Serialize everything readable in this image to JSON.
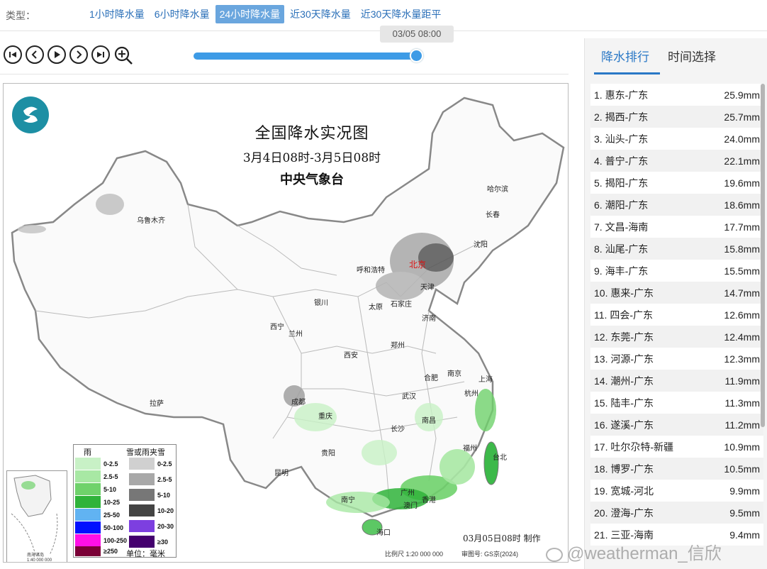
{
  "type_bar": {
    "label": "类型：",
    "tabs": [
      {
        "label": "1小时降水量"
      },
      {
        "label": "6小时降水量"
      },
      {
        "label": "24小时降水量",
        "active": true
      },
      {
        "label": "近30天降水量"
      },
      {
        "label": "近30天降水量距平"
      }
    ]
  },
  "timeline": {
    "current_time": "03/05 08:00",
    "progress": 1.0,
    "controls": [
      "first-icon",
      "prev-icon",
      "play-icon",
      "next-icon",
      "last-icon",
      "zoom-in-icon"
    ]
  },
  "map": {
    "title": "全国降水实况图",
    "period": "3月4日08时-3月5日08时",
    "agency": "中央气象台",
    "made_time": "03月05日08时 制作",
    "scale": "比例尺 1:20 000 000",
    "audit": "审图号: GS京(2024)",
    "inset_label": "南海诸岛\n1:40 000 000",
    "cities": [
      {
        "name": "乌鲁木齐"
      },
      {
        "name": "哈尔滨"
      },
      {
        "name": "长春"
      },
      {
        "name": "沈阳"
      },
      {
        "name": "北京",
        "capital": true
      },
      {
        "name": "呼和浩特"
      },
      {
        "name": "天津"
      },
      {
        "name": "石家庄"
      },
      {
        "name": "太原"
      },
      {
        "name": "银川"
      },
      {
        "name": "济南"
      },
      {
        "name": "西宁"
      },
      {
        "name": "兰州"
      },
      {
        "name": "西安"
      },
      {
        "name": "郑州"
      },
      {
        "name": "合肥"
      },
      {
        "name": "南京"
      },
      {
        "name": "上海"
      },
      {
        "name": "拉萨"
      },
      {
        "name": "成都"
      },
      {
        "name": "武汉"
      },
      {
        "name": "杭州"
      },
      {
        "name": "重庆"
      },
      {
        "name": "长沙"
      },
      {
        "name": "南昌"
      },
      {
        "name": "贵阳"
      },
      {
        "name": "福州"
      },
      {
        "name": "台北"
      },
      {
        "name": "昆明"
      },
      {
        "name": "南宁"
      },
      {
        "name": "广州"
      },
      {
        "name": "香港"
      },
      {
        "name": "澳门"
      },
      {
        "name": "海口"
      }
    ],
    "legend": {
      "rain_title": "雨",
      "snow_title": "雪或雨夹雪",
      "unit": "单位：毫米",
      "rain": [
        {
          "label": "0-2.5",
          "color": "#c8f1c6"
        },
        {
          "label": "2.5-5",
          "color": "#a8e8a4"
        },
        {
          "label": "5-10",
          "color": "#6fd26b"
        },
        {
          "label": "10-25",
          "color": "#2fb33a"
        },
        {
          "label": "25-50",
          "color": "#61b3f2"
        },
        {
          "label": "50-100",
          "color": "#0010ff"
        },
        {
          "label": "100-250",
          "color": "#ff10e6"
        },
        {
          "label": "≥250",
          "color": "#7a0036"
        }
      ],
      "snow": [
        {
          "label": "0-2.5",
          "color": "#d0d0d0"
        },
        {
          "label": "2.5-5",
          "color": "#a8a8a8"
        },
        {
          "label": "5-10",
          "color": "#777777"
        },
        {
          "label": "10-20",
          "color": "#444444"
        },
        {
          "label": "20-30",
          "color": "#7d3fe0"
        },
        {
          "label": "≥30",
          "color": "#44006e"
        }
      ]
    }
  },
  "panel": {
    "tabs": [
      {
        "label": "降水排行",
        "active": true
      },
      {
        "label": "时间选择"
      }
    ],
    "ranking": [
      {
        "rank": "1.",
        "station": "惠东-广东",
        "value": "25.9mm"
      },
      {
        "rank": "2.",
        "station": "揭西-广东",
        "value": "25.7mm"
      },
      {
        "rank": "3.",
        "station": "汕头-广东",
        "value": "24.0mm"
      },
      {
        "rank": "4.",
        "station": "普宁-广东",
        "value": "22.1mm"
      },
      {
        "rank": "5.",
        "station": "揭阳-广东",
        "value": "19.6mm"
      },
      {
        "rank": "6.",
        "station": "潮阳-广东",
        "value": "18.6mm"
      },
      {
        "rank": "7.",
        "station": "文昌-海南",
        "value": "17.7mm"
      },
      {
        "rank": "8.",
        "station": "汕尾-广东",
        "value": "15.8mm"
      },
      {
        "rank": "9.",
        "station": "海丰-广东",
        "value": "15.5mm"
      },
      {
        "rank": "10.",
        "station": "惠来-广东",
        "value": "14.7mm"
      },
      {
        "rank": "11.",
        "station": "四会-广东",
        "value": "12.6mm"
      },
      {
        "rank": "12.",
        "station": "东莞-广东",
        "value": "12.4mm"
      },
      {
        "rank": "13.",
        "station": "河源-广东",
        "value": "12.3mm"
      },
      {
        "rank": "14.",
        "station": "潮州-广东",
        "value": "11.9mm"
      },
      {
        "rank": "15.",
        "station": "陆丰-广东",
        "value": "11.3mm"
      },
      {
        "rank": "16.",
        "station": "遂溪-广东",
        "value": "11.2mm"
      },
      {
        "rank": "17.",
        "station": "吐尔尕特-新疆",
        "value": "10.9mm"
      },
      {
        "rank": "18.",
        "station": "博罗-广东",
        "value": "10.5mm"
      },
      {
        "rank": "19.",
        "station": "宽城-河北",
        "value": "9.9mm"
      },
      {
        "rank": "20.",
        "station": "澄海-广东",
        "value": "9.5mm"
      },
      {
        "rank": "21.",
        "station": "三亚-海南",
        "value": "9.4mm"
      }
    ]
  },
  "watermark": "@weatherman_信欣"
}
